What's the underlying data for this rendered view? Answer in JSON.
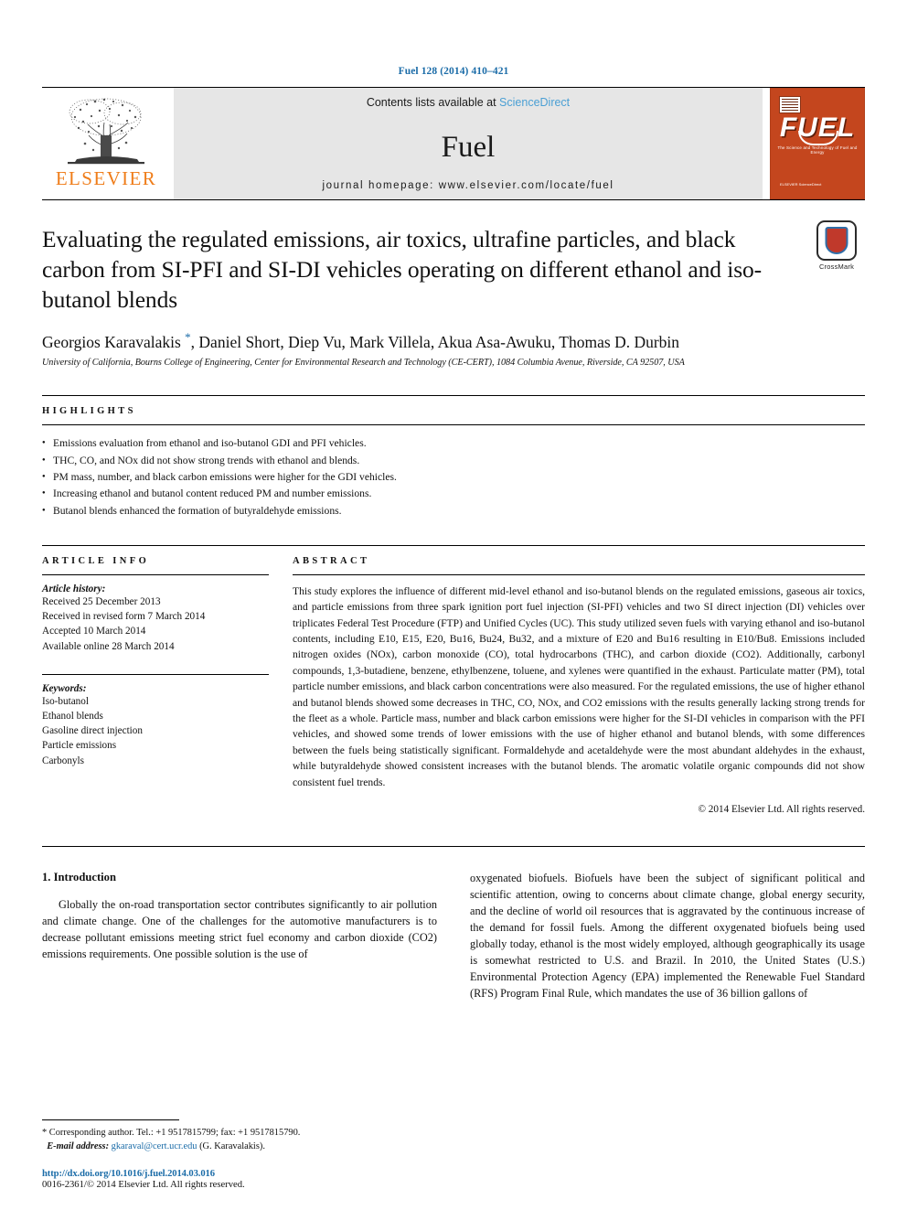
{
  "running_head": "Fuel 128 (2014) 410–421",
  "masthead": {
    "publisher_name": "ELSEVIER",
    "publisher_logo_alt": "elsevier-tree-logo",
    "contents_prefix": "Contents lists available at ",
    "contents_link": "ScienceDirect",
    "journal_name": "Fuel",
    "homepage": "journal homepage: www.elsevier.com/locate/fuel",
    "cover": {
      "title": "FUEL",
      "subtitle": "The Science and Technology of Fuel and Energy",
      "footer": "ELSEVIER\nScienceDirect"
    }
  },
  "article": {
    "title": "Evaluating the regulated emissions, air toxics, ultrafine particles, and black carbon from SI-PFI and SI-DI vehicles operating on different ethanol and iso-butanol blends",
    "authors": "Georgios Karavalakis ",
    "corresponding_marker": "*",
    "authors_rest": ", Daniel Short, Diep Vu, Mark Villela, Akua Asa-Awuku, Thomas D. Durbin",
    "affiliation": "University of California, Bourns College of Engineering, Center for Environmental Research and Technology (CE-CERT), 1084 Columbia Avenue, Riverside, CA 92507, USA",
    "crossmark_label": "CrossMark"
  },
  "highlights": {
    "heading": "HIGHLIGHTS",
    "items": [
      "Emissions evaluation from ethanol and iso-butanol GDI and PFI vehicles.",
      "THC, CO, and NOx did not show strong trends with ethanol and blends.",
      "PM mass, number, and black carbon emissions were higher for the GDI vehicles.",
      "Increasing ethanol and butanol content reduced PM and number emissions.",
      "Butanol blends enhanced the formation of butyraldehyde emissions."
    ]
  },
  "article_info": {
    "heading": "ARTICLE INFO",
    "history_label": "Article history:",
    "history": [
      "Received 25 December 2013",
      "Received in revised form 7 March 2014",
      "Accepted 10 March 2014",
      "Available online 28 March 2014"
    ],
    "keywords_label": "Keywords:",
    "keywords": [
      "Iso-butanol",
      "Ethanol blends",
      "Gasoline direct injection",
      "Particle emissions",
      "Carbonyls"
    ]
  },
  "abstract": {
    "heading": "ABSTRACT",
    "text": "This study explores the influence of different mid-level ethanol and iso-butanol blends on the regulated emissions, gaseous air toxics, and particle emissions from three spark ignition port fuel injection (SI-PFI) vehicles and two SI direct injection (DI) vehicles over triplicates Federal Test Procedure (FTP) and Unified Cycles (UC). This study utilized seven fuels with varying ethanol and iso-butanol contents, including E10, E15, E20, Bu16, Bu24, Bu32, and a mixture of E20 and Bu16 resulting in E10/Bu8. Emissions included nitrogen oxides (NOx), carbon monoxide (CO), total hydrocarbons (THC), and carbon dioxide (CO2). Additionally, carbonyl compounds, 1,3-butadiene, benzene, ethylbenzene, toluene, and xylenes were quantified in the exhaust. Particulate matter (PM), total particle number emissions, and black carbon concentrations were also measured. For the regulated emissions, the use of higher ethanol and butanol blends showed some decreases in THC, CO, NOx, and CO2 emissions with the results generally lacking strong trends for the fleet as a whole. Particle mass, number and black carbon emissions were higher for the SI-DI vehicles in comparison with the PFI vehicles, and showed some trends of lower emissions with the use of higher ethanol and butanol blends, with some differences between the fuels being statistically significant. Formaldehyde and acetaldehyde were the most abundant aldehydes in the exhaust, while butyraldehyde showed consistent increases with the butanol blends. The aromatic volatile organic compounds did not show consistent fuel trends.",
    "copyright": "© 2014 Elsevier Ltd. All rights reserved."
  },
  "body": {
    "section_number_title": "1. Introduction",
    "left_paragraph": "Globally the on-road transportation sector contributes significantly to air pollution and climate change. One of the challenges for the automotive manufacturers is to decrease pollutant emissions meeting strict fuel economy and carbon dioxide (CO2) emissions requirements. One possible solution is the use of",
    "right_paragraph": "oxygenated biofuels. Biofuels have been the subject of significant political and scientific attention, owing to concerns about climate change, global energy security, and the decline of world oil resources that is aggravated by the continuous increase of the demand for fossil fuels. Among the different oxygenated biofuels being used globally today, ethanol is the most widely employed, although geographically its usage is somewhat restricted to U.S. and Brazil. In 2010, the United States (U.S.) Environmental Protection Agency (EPA) implemented the Renewable Fuel Standard (RFS) Program Final Rule, which mandates the use of 36 billion gallons of"
  },
  "footer": {
    "corresponding_marker": "*",
    "corresponding_text": " Corresponding author. Tel.: +1 9517815799; fax: +1 9517815790.",
    "email_label": "E-mail address:",
    "email": "gkaraval@cert.ucr.edu",
    "email_owner": "(G. Karavalakis).",
    "doi": "http://dx.doi.org/10.1016/j.fuel.2014.03.016",
    "issn": "0016-2361/© 2014 Elsevier Ltd. All rights reserved."
  },
  "colors": {
    "link_blue": "#1b6ca8",
    "sciencedirect_blue": "#4a9fd4",
    "elsevier_orange": "#ef7d1a",
    "cover_orange": "#c4461e",
    "band_gray": "#e6e6e6"
  }
}
